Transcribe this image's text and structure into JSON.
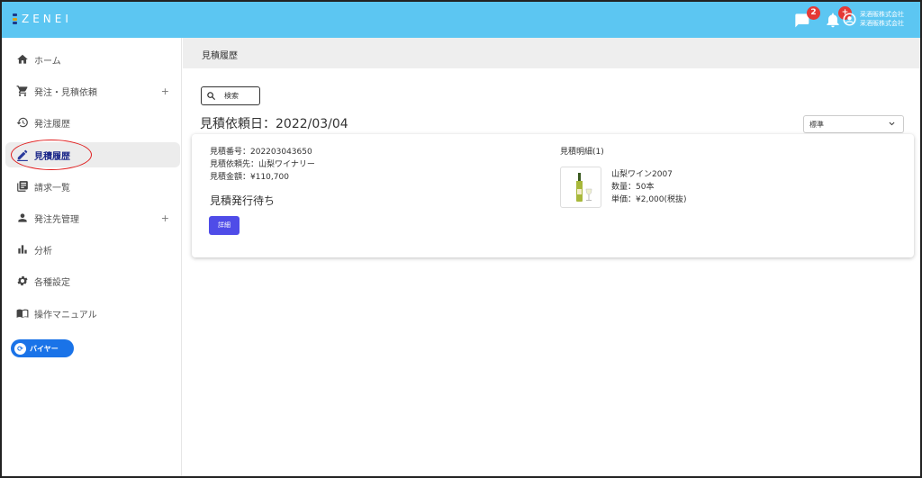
{
  "header": {
    "logo_text": "ZENEI",
    "messages_count": "2",
    "notifications_badge": "+",
    "account_line1": "采酒販株式会社",
    "account_line2": "采酒販株式会社"
  },
  "sidebar": {
    "items": [
      {
        "label": "ホーム",
        "icon": "home-icon"
      },
      {
        "label": "発注・見積依頼",
        "icon": "cart-icon",
        "expand": "+"
      },
      {
        "label": "発注履歴",
        "icon": "history-icon"
      },
      {
        "label": "見積履歴",
        "icon": "pencil-icon",
        "active": true
      },
      {
        "label": "請求一覧",
        "icon": "document-list-icon"
      },
      {
        "label": "発注先管理",
        "icon": "person-icon",
        "expand": "+"
      },
      {
        "label": "分析",
        "icon": "bar-chart-icon"
      },
      {
        "label": "各種設定",
        "icon": "gear-icon"
      },
      {
        "label": "操作マニュアル",
        "icon": "book-icon"
      }
    ],
    "role_button": "バイヤー"
  },
  "main": {
    "page_title": "見積履歴",
    "search_label": "検索",
    "date_title": "見積依頼日：2022/03/04",
    "sort_selected": "標準"
  },
  "quote": {
    "number": "見積番号：202203043650",
    "supplier": "見積依頼先：山梨ワイナリー",
    "amount": "見積金額：¥110,700",
    "status": "見積発行待ち",
    "detail_button": "詳細",
    "detail_header": "見積明細(1)",
    "product_name": "山梨ワイン2007",
    "quantity": "数量：50本",
    "unit_price": "単価：¥2,000(税抜)"
  },
  "colors": {
    "topbar": "#5cc6f2",
    "primary_button": "#4f4ce8",
    "buyer_button": "#1a73e8",
    "badge": "#e53935",
    "annotation": "#e02020"
  }
}
